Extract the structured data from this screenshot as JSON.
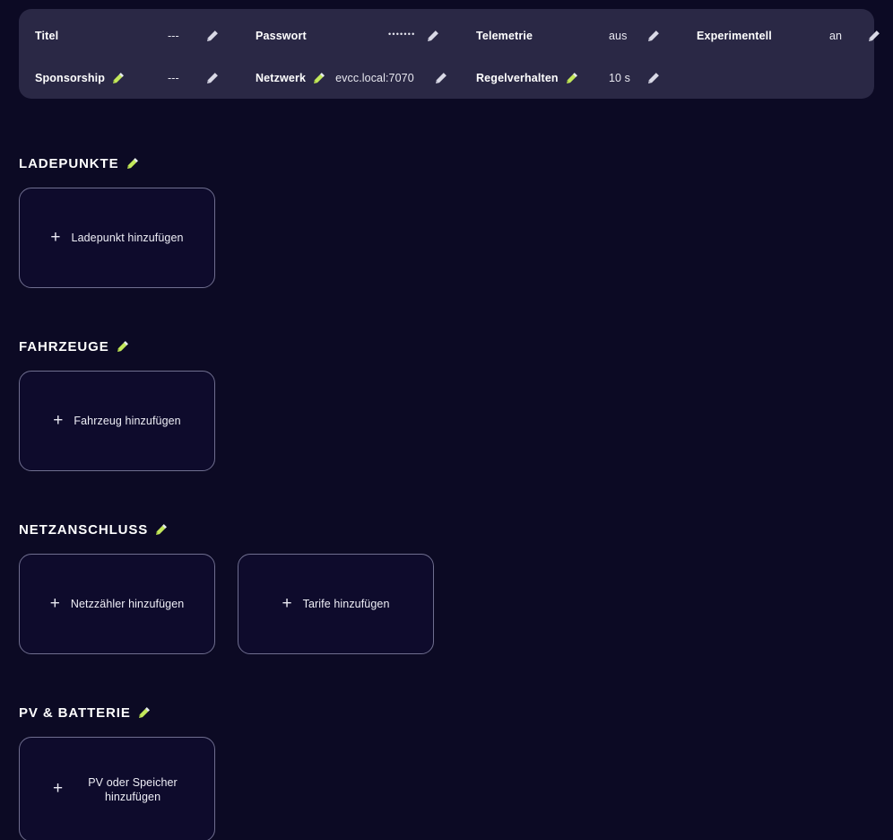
{
  "settings_panel": {
    "rows": [
      [
        {
          "label": "Titel",
          "value": "---",
          "label_editable": false,
          "value_kind": "text",
          "edit_icon": "pencil-icon"
        },
        {
          "label": "Passwort",
          "value": "•••••••",
          "label_editable": false,
          "value_kind": "password",
          "edit_icon": "pencil-icon"
        },
        {
          "label": "Telemetrie",
          "value": "aus",
          "label_editable": false,
          "value_kind": "text",
          "edit_icon": "pencil-icon"
        },
        {
          "label": "Experimentell",
          "value": "an",
          "label_editable": false,
          "value_kind": "text",
          "edit_icon": "pencil-icon"
        }
      ],
      [
        {
          "label": "Sponsorship",
          "value": "---",
          "label_editable": true,
          "value_kind": "text",
          "edit_icon": "pencil-icon"
        },
        {
          "label": "Netzwerk",
          "value": "evcc.local:7070",
          "label_editable": true,
          "value_kind": "text",
          "edit_icon": "pencil-icon"
        },
        {
          "label": "Regelverhalten",
          "value": "10 s",
          "label_editable": true,
          "value_kind": "text",
          "edit_icon": "pencil-icon"
        }
      ]
    ]
  },
  "sections": [
    {
      "title": "LADEPUNKTE",
      "edit_icon": "pencil-icon",
      "cards": [
        {
          "label": "Ladepunkt hinzufügen",
          "icon": "plus-icon",
          "wrap": false
        }
      ]
    },
    {
      "title": "FAHRZEUGE",
      "edit_icon": "pencil-icon",
      "cards": [
        {
          "label": "Fahrzeug hinzufügen",
          "icon": "plus-icon",
          "wrap": false
        }
      ]
    },
    {
      "title": "NETZANSCHLUSS",
      "edit_icon": "pencil-icon",
      "cards": [
        {
          "label": "Netzzähler hinzufügen",
          "icon": "plus-icon",
          "wrap": false
        },
        {
          "label": "Tarife hinzufügen",
          "icon": "plus-icon",
          "wrap": false
        }
      ]
    },
    {
      "title": "PV & BATTERIE",
      "edit_icon": "pencil-icon",
      "cards": [
        {
          "label": "PV oder Speicher hinzufügen",
          "icon": "plus-icon",
          "wrap": true
        }
      ]
    }
  ],
  "colors": {
    "page_background": "#0c0a24",
    "panel_background": "#2a2845",
    "card_background": "#0e0b2c",
    "card_border": "#6f6e8f",
    "accent_pencil": "#c3e85b",
    "neutral_pencil": "#d9d9e6",
    "text_primary": "#ffffff"
  }
}
